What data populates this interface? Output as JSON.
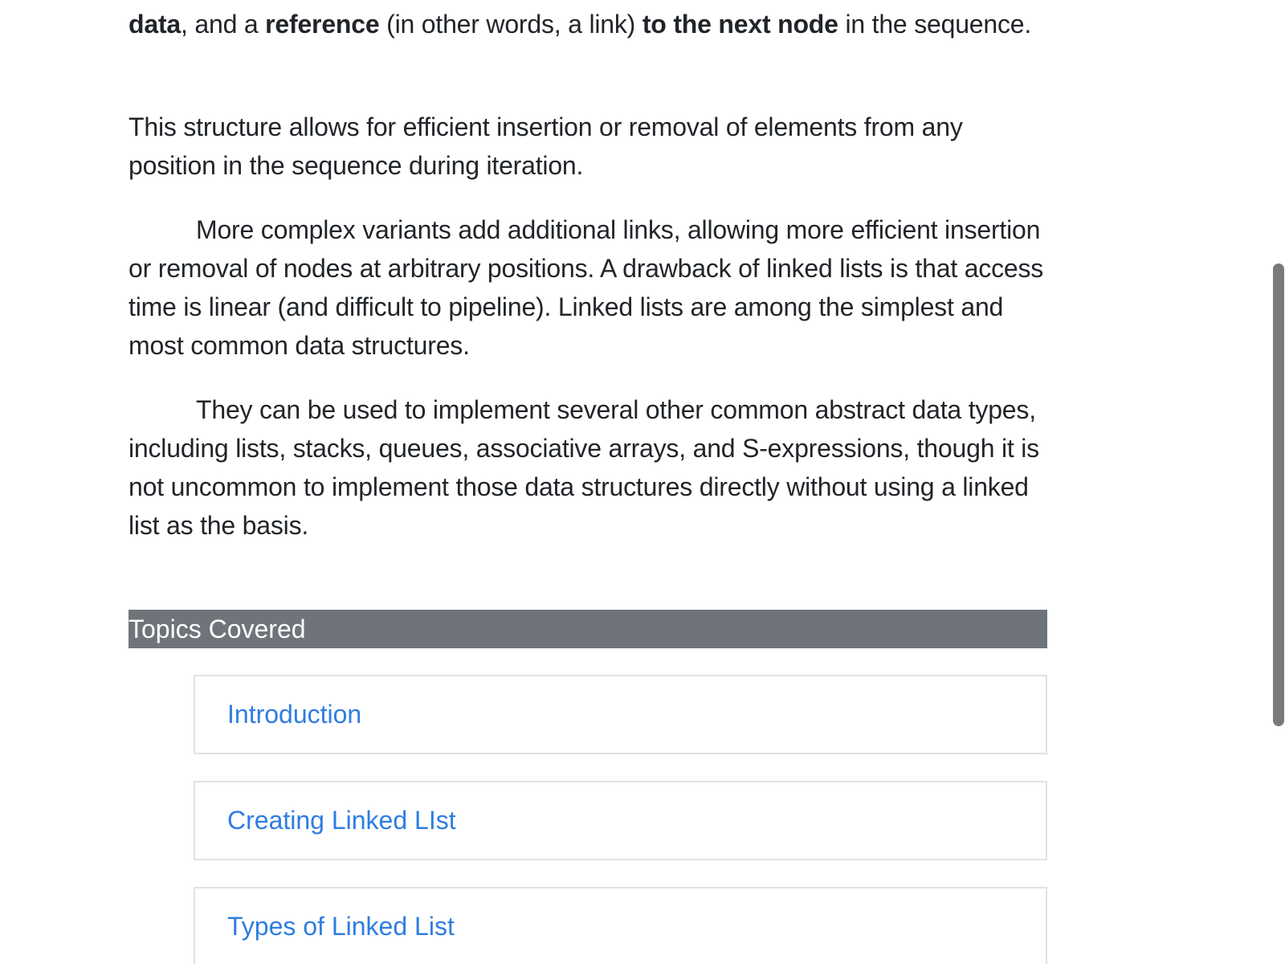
{
  "article": {
    "p1": {
      "b1": "data",
      "t1": ", and a ",
      "b2": "reference",
      "t2": " (in other words, a link) ",
      "b3": "to the next node",
      "t3": " in the sequence."
    },
    "p2": "This structure allows for efficient insertion or removal of elements from any position in the sequence during iteration.",
    "p3": "More complex variants add additional links, allowing more efficient insertion or removal of nodes at arbitrary positions. A drawback of linked lists is that access time is linear (and difficult to pipeline). Linked lists are among the simplest and most common data structures.",
    "p4": "They can be used to implement several other common abstract data types, including lists, stacks, queues, associative arrays, and S-expressions, though it is not uncommon to implement those data structures directly without using a linked list as the basis."
  },
  "topics": {
    "header": "Topics Covered",
    "items": [
      {
        "label": "Introduction"
      },
      {
        "label": "Creating Linked LIst"
      },
      {
        "label": "Types of Linked List"
      }
    ]
  },
  "colors": {
    "header_bg": "#6f747b",
    "link": "#2f7de1",
    "text": "#212529",
    "card_border": "#e2e2e2"
  }
}
